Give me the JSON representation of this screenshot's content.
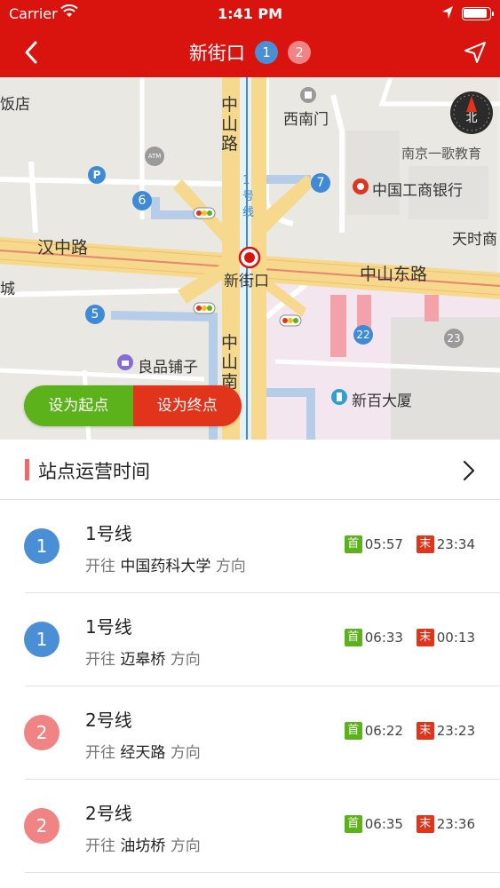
{
  "status_bar": {
    "carrier": "Carrier",
    "time": "1:41 PM"
  },
  "nav": {
    "title": "新街口",
    "lines": [
      "1",
      "2"
    ],
    "line_colors": [
      "#4a8fd6",
      "#f08383"
    ]
  },
  "map": {
    "labels": {
      "hotel": "饭店",
      "zhongshan_road_north": "中山路",
      "ximennan": "西南门",
      "education": "南京一歌教育",
      "line1_label": "1号线",
      "bank": "中国工商银行",
      "tianshi": "天时商",
      "hanzhong_road": "汉中路",
      "xinjiekou": "新街口",
      "zhongshan_east_road": "中山东路",
      "snack_shop": "良品铺子",
      "zhongshan_south": "中山南",
      "department_store": "新百大厦",
      "exit_6": "6",
      "exit_7": "7",
      "exit_5": "5",
      "bus_22": "22",
      "bus_23": "23",
      "parking": "P",
      "atm": "ATM",
      "city_fragment": "城"
    },
    "compass_label": "北",
    "set_start": "设为起点",
    "set_end": "设为终点"
  },
  "section": {
    "title": "站点运营时间"
  },
  "lines": [
    {
      "num": "1",
      "name": "1号线",
      "prefix": "开往",
      "dest": "中国药科大学",
      "suffix": "方向",
      "first_label": "首",
      "first": "05:57",
      "last_label": "末",
      "last": "23:34",
      "color": "#4a8fd6"
    },
    {
      "num": "1",
      "name": "1号线",
      "prefix": "开往",
      "dest": "迈皋桥",
      "suffix": "方向",
      "first_label": "首",
      "first": "06:33",
      "last_label": "末",
      "last": "00:13",
      "color": "#4a8fd6"
    },
    {
      "num": "2",
      "name": "2号线",
      "prefix": "开往",
      "dest": "经天路",
      "suffix": "方向",
      "first_label": "首",
      "first": "06:22",
      "last_label": "末",
      "last": "23:23",
      "color": "#f08383"
    },
    {
      "num": "2",
      "name": "2号线",
      "prefix": "开往",
      "dest": "油坊桥",
      "suffix": "方向",
      "first_label": "首",
      "first": "06:35",
      "last_label": "末",
      "last": "23:36",
      "color": "#f08383"
    }
  ]
}
